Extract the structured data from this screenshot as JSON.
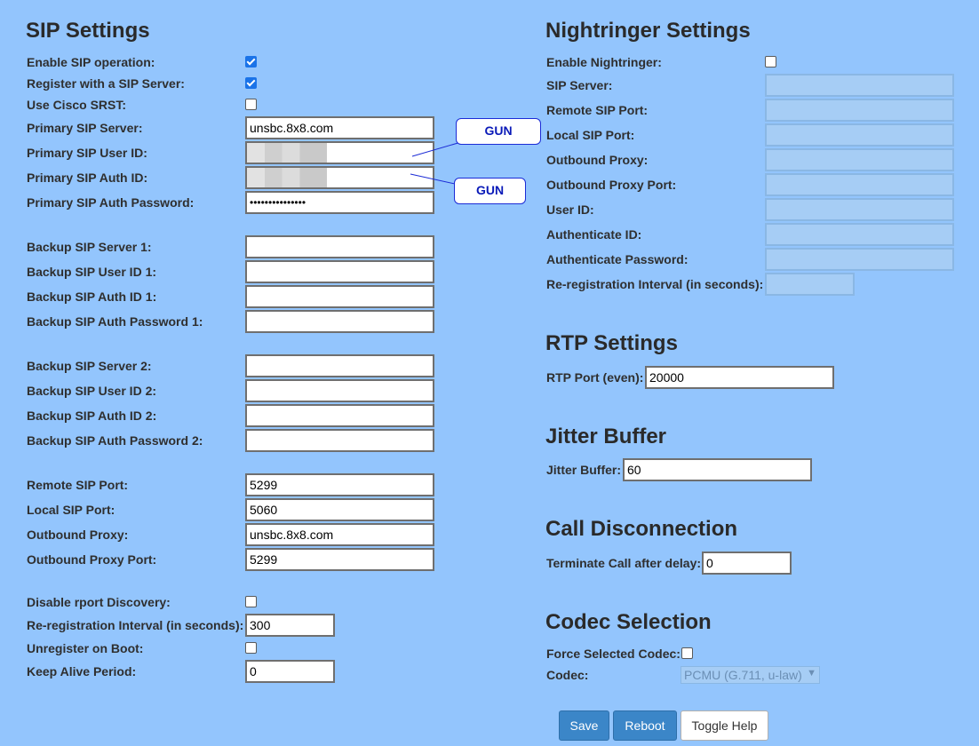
{
  "sip": {
    "title": "SIP Settings",
    "enable_sip": {
      "label": "Enable SIP operation:",
      "checked": true
    },
    "register_sip": {
      "label": "Register with a SIP Server:",
      "checked": true
    },
    "cisco_srst": {
      "label": "Use Cisco SRST:",
      "checked": false
    },
    "primary_server": {
      "label": "Primary SIP Server:",
      "value": "unsbc.8x8.com"
    },
    "primary_user_id": {
      "label": "Primary SIP User ID:",
      "value": ""
    },
    "primary_auth_id": {
      "label": "Primary SIP Auth ID:",
      "value": ""
    },
    "primary_auth_password": {
      "label": "Primary SIP Auth Password:",
      "value": "•••••••••••••••"
    },
    "backup1_server": {
      "label": "Backup SIP Server 1:",
      "value": ""
    },
    "backup1_user_id": {
      "label": "Backup SIP User ID 1:",
      "value": ""
    },
    "backup1_auth_id": {
      "label": "Backup SIP Auth ID 1:",
      "value": ""
    },
    "backup1_auth_password": {
      "label": "Backup SIP Auth Password 1:",
      "value": ""
    },
    "backup2_server": {
      "label": "Backup SIP Server 2:",
      "value": ""
    },
    "backup2_user_id": {
      "label": "Backup SIP User ID 2:",
      "value": ""
    },
    "backup2_auth_id": {
      "label": "Backup SIP Auth ID 2:",
      "value": ""
    },
    "backup2_auth_password": {
      "label": "Backup SIP Auth Password 2:",
      "value": ""
    },
    "remote_port": {
      "label": "Remote SIP Port:",
      "value": "5299"
    },
    "local_port": {
      "label": "Local SIP Port:",
      "value": "5060"
    },
    "outbound_proxy": {
      "label": "Outbound Proxy:",
      "value": "unsbc.8x8.com"
    },
    "outbound_proxy_port": {
      "label": "Outbound Proxy Port:",
      "value": "5299"
    },
    "disable_rport": {
      "label": "Disable rport Discovery:",
      "checked": false
    },
    "rereg_interval": {
      "label": "Re-registration Interval (in seconds):",
      "value": "300"
    },
    "unregister_boot": {
      "label": "Unregister on Boot:",
      "checked": false
    },
    "keep_alive": {
      "label": "Keep Alive Period:",
      "value": "0"
    }
  },
  "callouts": {
    "first": "GUN",
    "second": "GUN"
  },
  "nightringer": {
    "title": "Nightringer Settings",
    "enable": {
      "label": "Enable Nightringer:",
      "checked": false
    },
    "sip_server": {
      "label": "SIP Server:",
      "value": ""
    },
    "remote_port": {
      "label": "Remote SIP Port:",
      "value": ""
    },
    "local_port": {
      "label": "Local SIP Port:",
      "value": ""
    },
    "outbound_proxy": {
      "label": "Outbound Proxy:",
      "value": ""
    },
    "outbound_proxy_port": {
      "label": "Outbound Proxy Port:",
      "value": ""
    },
    "user_id": {
      "label": "User ID:",
      "value": ""
    },
    "auth_id": {
      "label": "Authenticate ID:",
      "value": ""
    },
    "auth_password": {
      "label": "Authenticate Password:",
      "value": ""
    },
    "rereg_interval": {
      "label": "Re-registration Interval (in seconds):",
      "value": ""
    }
  },
  "rtp": {
    "title": "RTP Settings",
    "port": {
      "label": "RTP Port (even):",
      "value": "20000"
    }
  },
  "jitter": {
    "title": "Jitter Buffer",
    "buffer": {
      "label": "Jitter Buffer:",
      "value": "60"
    }
  },
  "disconnect": {
    "title": "Call Disconnection",
    "delay": {
      "label": "Terminate Call after delay:",
      "value": "0"
    }
  },
  "codec": {
    "title": "Codec Selection",
    "force": {
      "label": "Force Selected Codec:",
      "checked": false
    },
    "codec": {
      "label": "Codec:",
      "selected": "PCMU (G.711, u-law)"
    }
  },
  "buttons": {
    "save": "Save",
    "reboot": "Reboot",
    "toggle_help": "Toggle Help"
  },
  "colors": {
    "background": "#93c5fd",
    "button_primary": "#3b86c8",
    "callout_text": "#0a1ab8"
  }
}
